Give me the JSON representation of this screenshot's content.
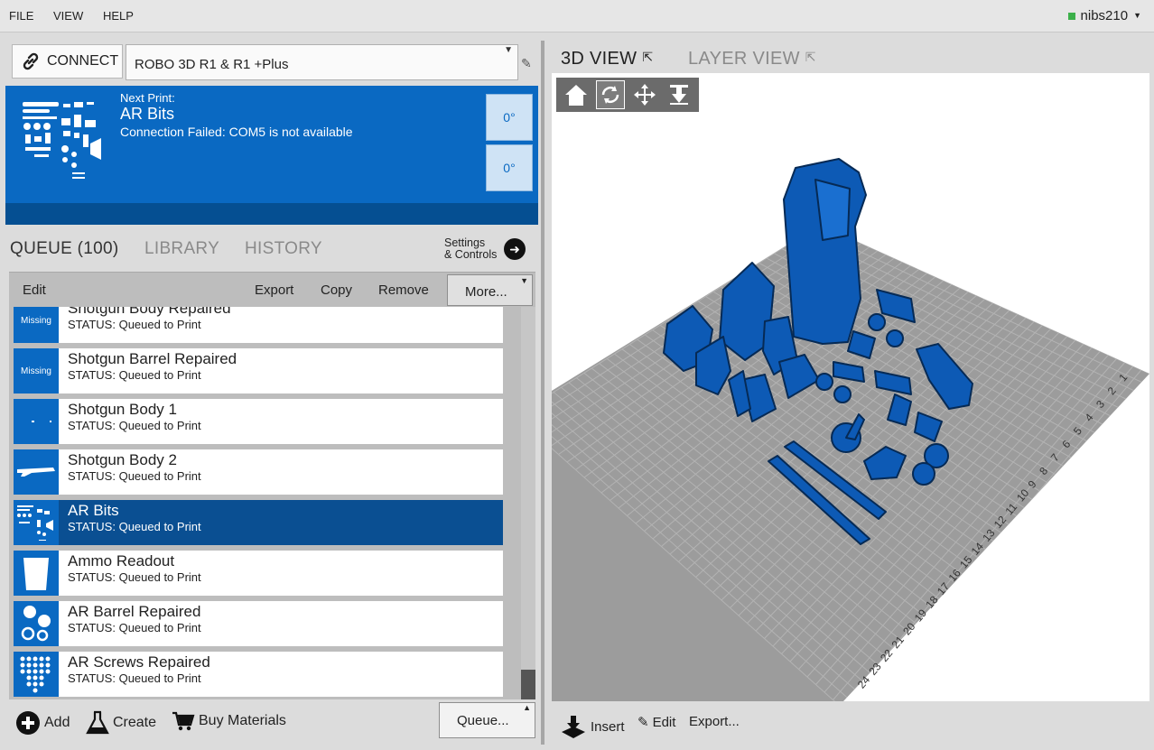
{
  "menu": {
    "file": "FILE",
    "view": "VIEW",
    "help": "HELP"
  },
  "user": {
    "name": "nibs210",
    "status_color": "#3cb04a"
  },
  "printer": {
    "connect_label": "CONNECT",
    "selected": "ROBO 3D R1 & R1 +Plus"
  },
  "status": {
    "next_label": "Next Print:",
    "next_name": "AR Bits",
    "message": "Connection Failed: COM5 is not available",
    "temp_extruder": "0°",
    "temp_bed": "0°"
  },
  "tabs": {
    "queue": "QUEUE (100)",
    "library": "LIBRARY",
    "history": "HISTORY",
    "settings_line1": "Settings",
    "settings_line2": "& Controls"
  },
  "toolbar": {
    "edit": "Edit",
    "export": "Export",
    "copy": "Copy",
    "remove": "Remove",
    "more": "More..."
  },
  "queue": {
    "items": [
      {
        "name": "Shotgun Body Repaired",
        "status": "STATUS: Queued to Print",
        "thumb": "Missing"
      },
      {
        "name": "Shotgun Barrel Repaired",
        "status": "STATUS: Queued to Print",
        "thumb": "Missing"
      },
      {
        "name": "Shotgun Body 1",
        "status": "STATUS: Queued to Print",
        "thumb": ""
      },
      {
        "name": "Shotgun Body 2",
        "status": "STATUS: Queued to Print",
        "thumb": ""
      },
      {
        "name": "AR Bits",
        "status": "STATUS: Queued to Print",
        "thumb": ""
      },
      {
        "name": "Ammo Readout",
        "status": "STATUS: Queued to Print",
        "thumb": ""
      },
      {
        "name": "AR Barrel Repaired",
        "status": "STATUS: Queued to Print",
        "thumb": ""
      },
      {
        "name": "AR Screws Repaired",
        "status": "STATUS: Queued to Print",
        "thumb": ""
      }
    ]
  },
  "bottom": {
    "add": "Add",
    "create": "Create",
    "buy": "Buy Materials",
    "queue_menu": "Queue..."
  },
  "view": {
    "tab_3d": "3D VIEW",
    "tab_layer": "LAYER VIEW",
    "insert": "Insert",
    "edit": "Edit",
    "export": "Export...",
    "bed_numbers": [
      "1",
      "2",
      "3",
      "4",
      "5",
      "6",
      "7",
      "8",
      "9",
      "10",
      "11",
      "12",
      "13",
      "14",
      "15",
      "16",
      "17",
      "18",
      "19",
      "20",
      "21",
      "22",
      "23",
      "24"
    ]
  },
  "colors": {
    "accent": "#0a69c2",
    "accent_dark": "#054f92",
    "model_blue": "#0d5ab5",
    "bed_gray": "#9a9a9a"
  }
}
